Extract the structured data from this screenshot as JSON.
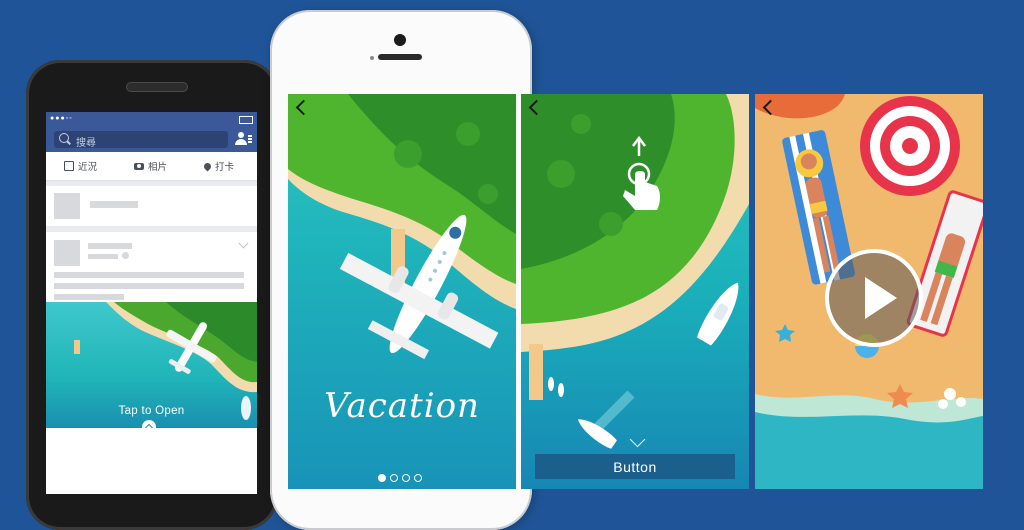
{
  "colors": {
    "background": "#1f5598",
    "facebook_blue": "#3b5998",
    "button_blue": "#1b5f8d"
  },
  "facebook": {
    "search_placeholder": "搜尋",
    "actions": [
      {
        "label": "近況",
        "icon": "edit-icon"
      },
      {
        "label": "相片",
        "icon": "camera-icon"
      },
      {
        "label": "打卡",
        "icon": "location-pin-icon"
      }
    ],
    "ad": {
      "cta": "Tap to Open"
    },
    "tabbar": [
      "news-feed-icon",
      "friends-icon",
      "messenger-icon",
      "globe-icon",
      "menu-icon"
    ]
  },
  "panels": {
    "vacation": {
      "title": "Vacation",
      "pager_total": 4,
      "pager_active": 1
    },
    "swipe": {
      "button_label": "Button"
    },
    "video": {
      "play_icon": "play-icon"
    }
  }
}
